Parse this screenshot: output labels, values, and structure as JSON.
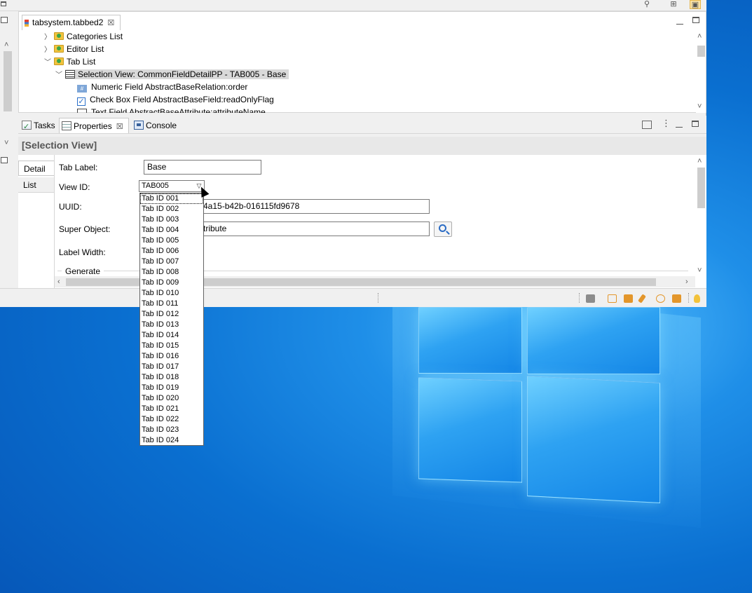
{
  "editor": {
    "tab_title": "tabsystem.tabbed2",
    "tree": [
      {
        "label": "Categories List",
        "level": 1,
        "icon": "folder-icon",
        "expanded": false
      },
      {
        "label": "Editor List",
        "level": 1,
        "icon": "folder-icon",
        "expanded": false
      },
      {
        "label": "Tab List",
        "level": 1,
        "icon": "folder-icon",
        "expanded": true
      },
      {
        "label": "Selection View: CommonFieldDetailPP - TAB005 - Base",
        "level": 2,
        "icon": "selection-view-icon",
        "expanded": true,
        "selected": true
      },
      {
        "label": "Numeric Field AbstractBaseRelation:order",
        "level": 3,
        "icon": "numeric-field-icon"
      },
      {
        "label": "Check Box Field AbstractBaseField:readOnlyFlag",
        "level": 3,
        "icon": "check-box-icon"
      },
      {
        "label": "Text Field AbstractBaseAttribute:attributeName",
        "level": 3,
        "icon": "text-field-icon"
      }
    ]
  },
  "views": {
    "tabs": [
      {
        "label": "Tasks",
        "active": false
      },
      {
        "label": "Properties",
        "active": true
      },
      {
        "label": "Console",
        "active": false
      }
    ],
    "header": "[Selection View]",
    "side_tabs": [
      "Detail",
      "List"
    ]
  },
  "form": {
    "tab_label": {
      "label": "Tab Label:",
      "value": "Base"
    },
    "view_id": {
      "label": "View ID:",
      "value": "TAB005"
    },
    "uuid": {
      "label": "UUID:",
      "value_visible": "4a15-b42b-016115fd9678"
    },
    "super_object": {
      "label": "Super Object:",
      "value_visible": "tribute"
    },
    "label_width": {
      "label": "Label Width:"
    },
    "group_label": "Generate"
  },
  "dropdown": {
    "items": [
      "Tab ID 001",
      "Tab ID 002",
      "Tab ID 003",
      "Tab ID 004",
      "Tab ID 005",
      "Tab ID 006",
      "Tab ID 007",
      "Tab ID 008",
      "Tab ID 009",
      "Tab ID 010",
      "Tab ID 011",
      "Tab ID 012",
      "Tab ID 013",
      "Tab ID 014",
      "Tab ID 015",
      "Tab ID 016",
      "Tab ID 017",
      "Tab ID 018",
      "Tab ID 019",
      "Tab ID 020",
      "Tab ID 021",
      "Tab ID 022",
      "Tab ID 023",
      "Tab ID 024"
    ],
    "focused_index": 0
  },
  "colors": {
    "accent": "#2b6cc4",
    "folder": "#f2c33e",
    "desktop": "#0a6fd0"
  }
}
